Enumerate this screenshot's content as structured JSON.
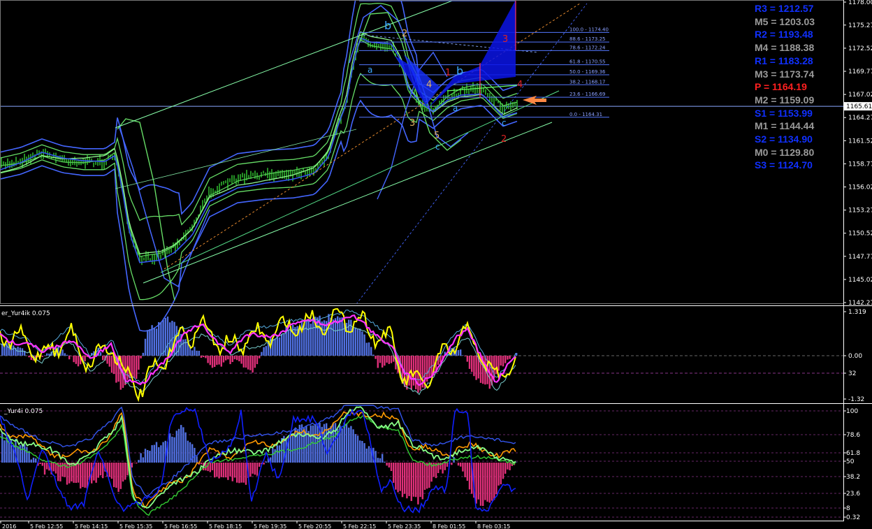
{
  "colors": {
    "background": "#000000",
    "grid_border": "#ffffff",
    "price_axis_text": "#ffffff",
    "candles": "#33cc33",
    "bands_outer": "#4466ff",
    "bands_inner": "#66dd66",
    "channel": "#88ffaa",
    "fib": "#5577ff",
    "pattern_fill": "#0a14e6",
    "pivot_R": "#1030ff",
    "pivot_M": "#9a9a9a",
    "pivot_S": "#1030ff",
    "pivot_P": "#ff2020",
    "osc_hist_pos": "#5070e0",
    "osc_hist_neg": "#e0307a",
    "osc_yellow": "#ffff00",
    "osc_magenta": "#ff33ff",
    "osc_cyan": "#44dddd",
    "osc_blue": "#1020ff",
    "arrow": "#ff8844"
  },
  "main_chart": {
    "price_ticks": [
      "1178.00",
      "1175.27",
      "1172.52",
      "1169.77",
      "1167.02",
      "1164.27",
      "1161.52",
      "1158.77",
      "1156.02",
      "1153.27",
      "1150.52",
      "1147.77",
      "1145.02",
      "1142.27"
    ],
    "current_price": "1165.61",
    "fib_levels": [
      {
        "label": "100.0 - 1174.40",
        "price": 1174.4
      },
      {
        "label": "88.6 - 1173.25",
        "price": 1173.25
      },
      {
        "label": "78.6 - 1172.24",
        "price": 1172.24
      },
      {
        "label": "61.8 - 1170.55",
        "price": 1170.55
      },
      {
        "label": "50.0 - 1169.36",
        "price": 1169.36
      },
      {
        "label": "38.2 - 1168.17",
        "price": 1168.17
      },
      {
        "label": "23.6 - 1166.69",
        "price": 1166.69
      },
      {
        "label": "0.0 - 1164.31",
        "price": 1164.31
      }
    ],
    "wave_labels_blue": [
      "b",
      "a",
      "b",
      "a",
      "c",
      "c"
    ],
    "wave_labels_gold": [
      "2",
      "4",
      "3",
      "5"
    ],
    "wave_labels_red": [
      "1",
      "3",
      "4",
      "2"
    ]
  },
  "pivots": [
    {
      "label": "R3 = 1212.57",
      "type": "R"
    },
    {
      "label": "M5 = 1203.03",
      "type": "M"
    },
    {
      "label": "R2 = 1193.48",
      "type": "R"
    },
    {
      "label": "M4 = 1188.38",
      "type": "M"
    },
    {
      "label": "R1 = 1183.28",
      "type": "R"
    },
    {
      "label": "M3 = 1173.74",
      "type": "M"
    },
    {
      "label": "P   = 1164.19",
      "type": "P"
    },
    {
      "label": "M2 = 1159.09",
      "type": "M"
    },
    {
      "label": "S1 = 1153.99",
      "type": "S"
    },
    {
      "label": "M1 = 1144.44",
      "type": "M"
    },
    {
      "label": "S2 = 1134.90",
      "type": "S"
    },
    {
      "label": "M0 = 1129.80",
      "type": "M"
    },
    {
      "label": "S3 = 1124.70",
      "type": "S"
    }
  ],
  "osc1": {
    "title": "er_Yur4ik 0.075",
    "ticks": [
      "1.319",
      "0.00",
      "32",
      "-1.32"
    ]
  },
  "osc2": {
    "title": "_Yur4i 0.075",
    "ticks": [
      "100",
      "78.6",
      "61.8",
      "50",
      "38.2",
      "23.6",
      "8",
      "0.32"
    ]
  },
  "time_axis": [
    "2016",
    "5 Feb 12:55",
    "5 Feb 14:15",
    "5 Feb 15:35",
    "5 Feb 16:55",
    "5 Feb 18:15",
    "5 Feb 19:35",
    "5 Feb 20:55",
    "5 Feb 22:15",
    "5 Feb 23:35",
    "8 Feb 01:55",
    "8 Feb 03:15"
  ]
}
